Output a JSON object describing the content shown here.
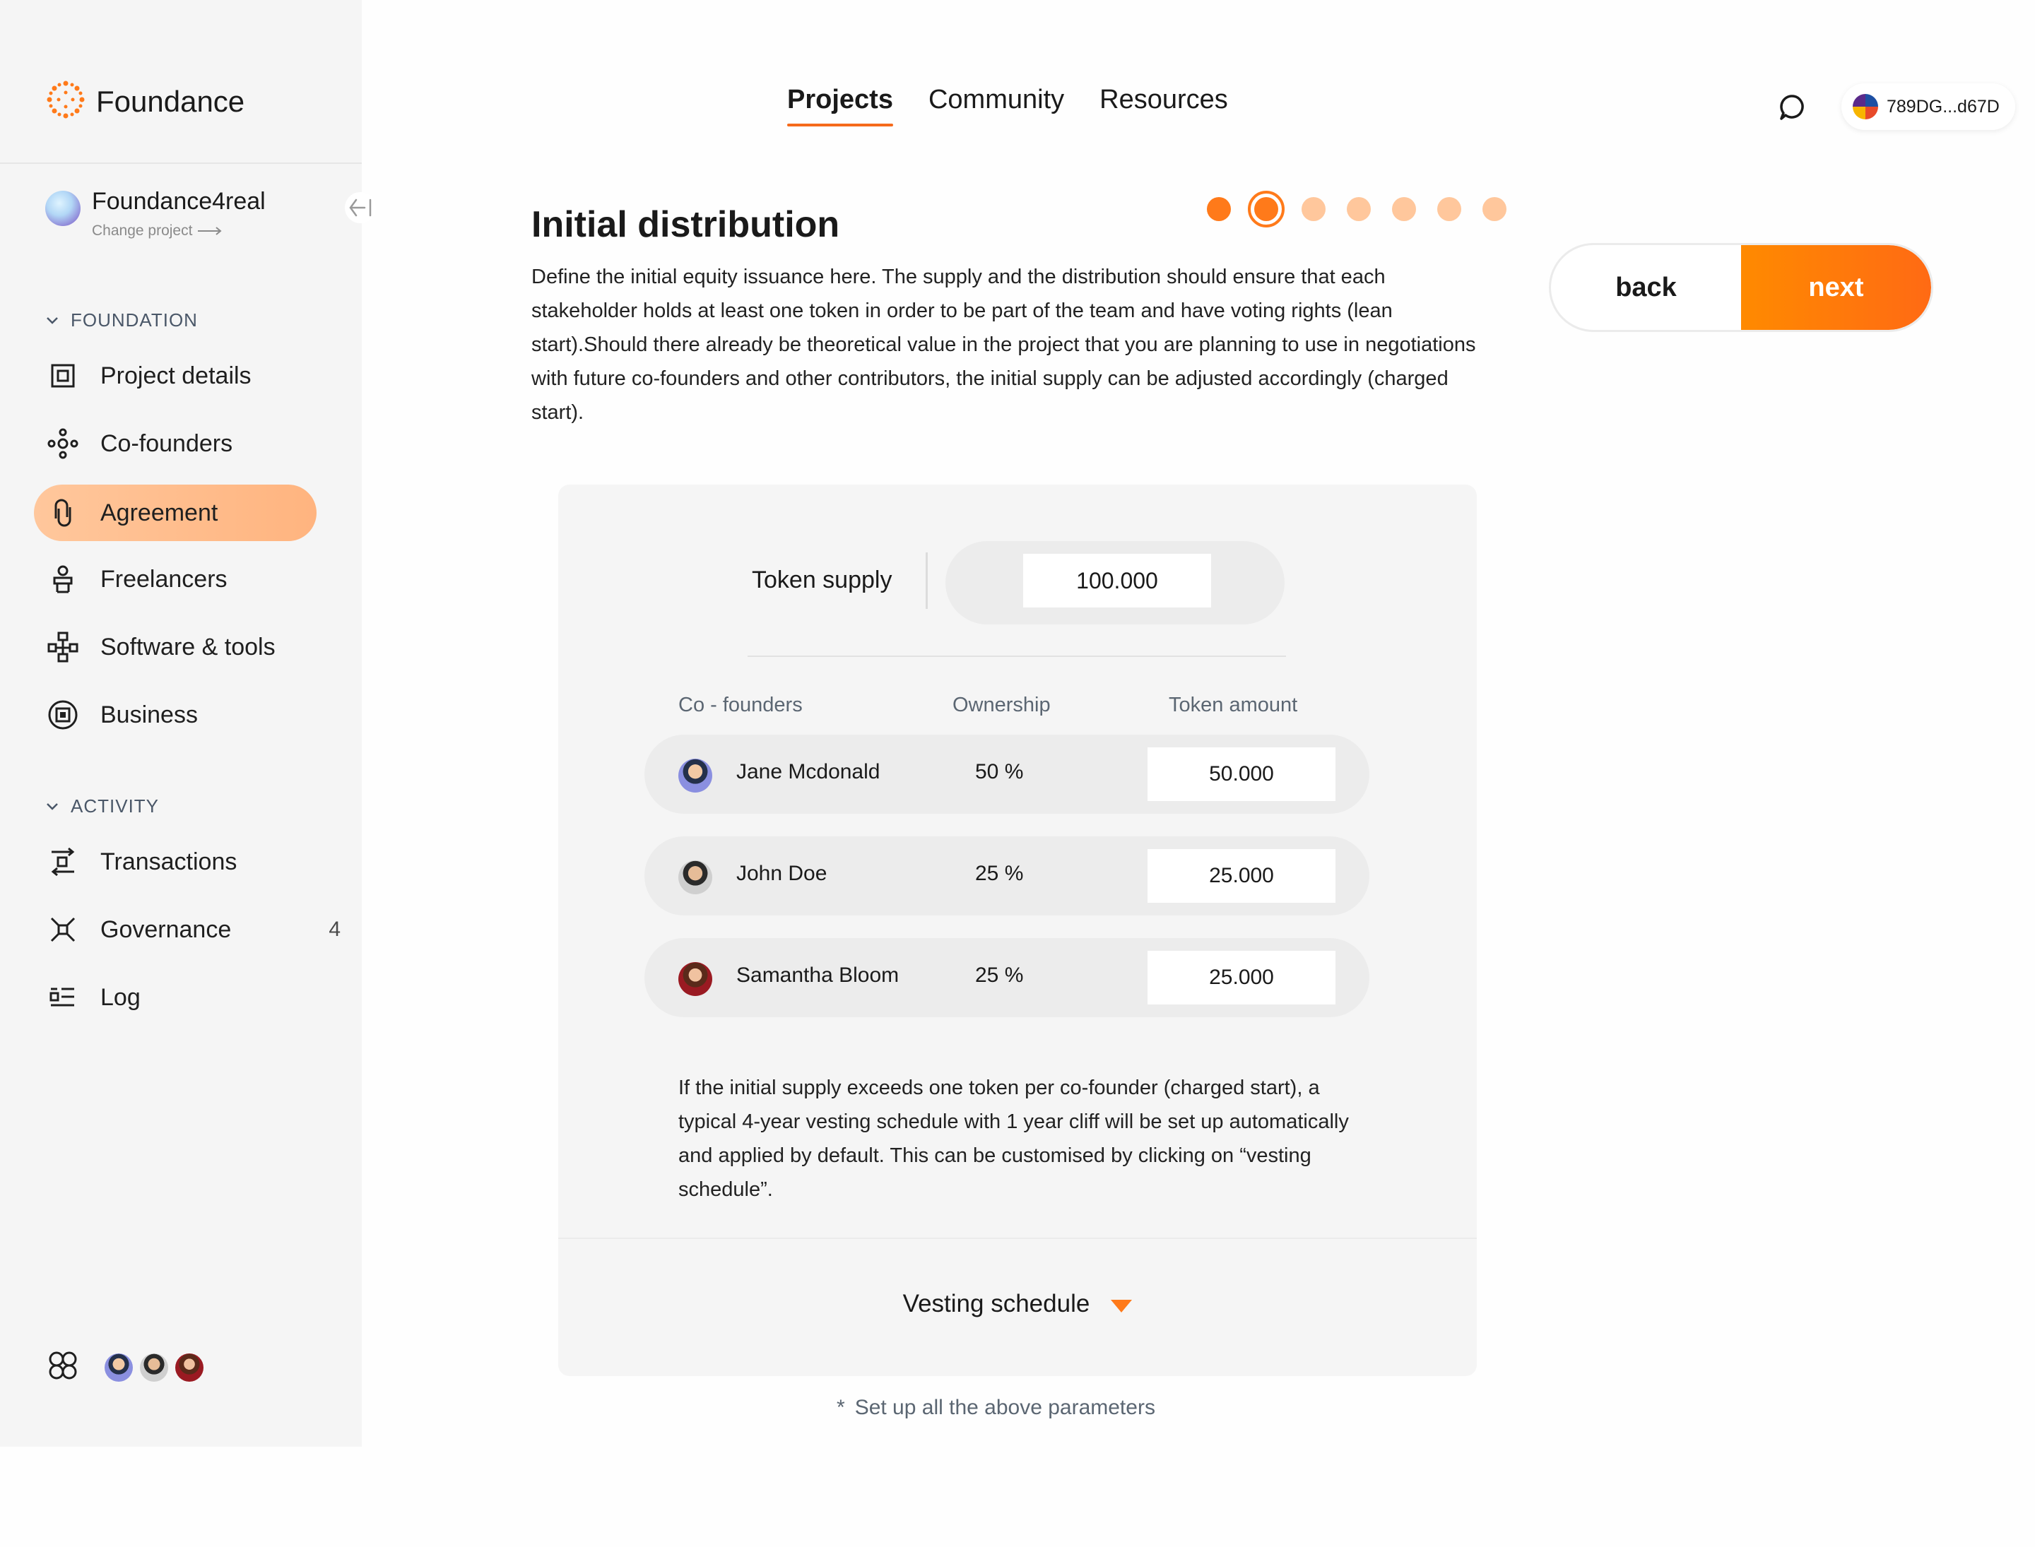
{
  "brand": {
    "name": "Foundance"
  },
  "project": {
    "name": "Foundance4real",
    "change_label": "Change project"
  },
  "sidebar": {
    "foundation_heading": "FOUNDATION",
    "foundation_items": [
      {
        "label": "Project details",
        "icon": "project-details-icon"
      },
      {
        "label": "Co-founders",
        "icon": "co-founders-icon"
      },
      {
        "label": "Agreement",
        "icon": "agreement-icon",
        "active": true
      },
      {
        "label": "Freelancers",
        "icon": "freelancers-icon"
      },
      {
        "label": "Software & tools",
        "icon": "software-tools-icon"
      },
      {
        "label": "Business",
        "icon": "business-icon"
      }
    ],
    "activity_heading": "ACTIVITY",
    "activity_items": [
      {
        "label": "Transactions",
        "icon": "transactions-icon"
      },
      {
        "label": "Governance",
        "icon": "governance-icon",
        "badge": "4"
      },
      {
        "label": "Log",
        "icon": "log-icon"
      }
    ]
  },
  "topnav": {
    "tabs": [
      "Projects",
      "Community",
      "Resources"
    ],
    "active": "Projects"
  },
  "wallet": {
    "address": "789DG...d67D"
  },
  "page": {
    "title": "Initial distribution",
    "description": "Define the initial equity issuance here. The supply and the distribution should ensure that each stakeholder holds at least one token in order to be part of the team and have voting rights (lean start).Should there already be theoretical value in the project that you are planning to use in negotiations with future co-founders and other contributors, the initial supply can be adjusted accordingly (charged start).",
    "steps_total": 7,
    "current_step": 2
  },
  "buttons": {
    "back": "back",
    "next": "next"
  },
  "distribution": {
    "token_supply_label": "Token supply",
    "token_supply_value": "100.000",
    "columns": [
      "Co - founders",
      "Ownership",
      "Token amount"
    ],
    "rows": [
      {
        "name": "Jane Mcdonald",
        "ownership": "50 %",
        "tokens": "50.000"
      },
      {
        "name": "John Doe",
        "ownership": "25 %",
        "tokens": "25.000"
      },
      {
        "name": "Samantha Bloom",
        "ownership": "25 %",
        "tokens": "25.000"
      }
    ],
    "note": "If the initial supply exceeds one token per co-founder (charged start), a typical 4-year vesting schedule with 1 year cliff will be set up automatically and applied by default. This can be customised by clicking on “vesting schedule”.",
    "vesting_label": "Vesting schedule"
  },
  "hint": {
    "asterisk": "*",
    "text": "Set up all the above parameters"
  },
  "colors": {
    "accent": "#ff7a1a",
    "accent_light": "#ffc79c",
    "sidebar_bg": "#f5f5f5"
  }
}
